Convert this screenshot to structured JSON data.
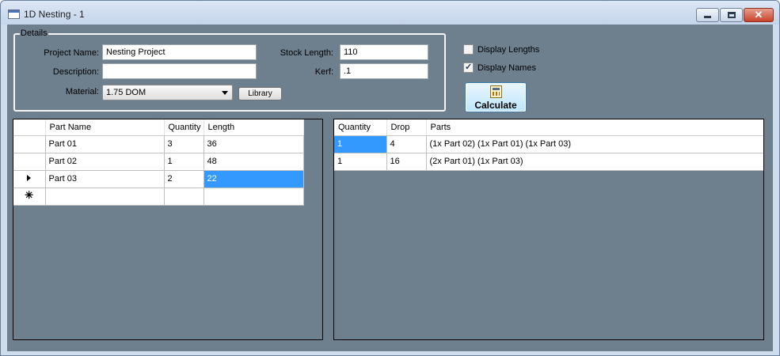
{
  "window": {
    "title": "1D Nesting - 1",
    "close_glyph": "✕"
  },
  "details": {
    "group_label": "Details",
    "project_name_label": "Project Name:",
    "project_name_value": "Nesting Project",
    "description_label": "Description:",
    "description_value": "",
    "material_label": "Material:",
    "material_value": "1.75 DOM",
    "library_button": "Library",
    "stock_length_label": "Stock Length:",
    "stock_length_value": "110",
    "kerf_label": "Kerf:",
    "kerf_value": ".1"
  },
  "options": {
    "display_lengths_label": "Display Lengths",
    "display_lengths_checked": false,
    "display_names_label": "Display Names",
    "display_names_checked": true
  },
  "calculate_button": "Calculate",
  "parts_grid": {
    "columns": [
      "Part Name",
      "Quantity",
      "Length"
    ],
    "new_row_marker": "✳",
    "rows": [
      {
        "name": "Part 01",
        "quantity": "3",
        "length": "36"
      },
      {
        "name": "Part 02",
        "quantity": "1",
        "length": "48"
      },
      {
        "name": "Part 03",
        "quantity": "2",
        "length": "22"
      }
    ],
    "current_row": 2
  },
  "results_grid": {
    "columns": [
      "Quantity",
      "Drop",
      "Parts"
    ],
    "rows": [
      {
        "quantity": "1",
        "drop": "4",
        "parts": "(1x Part 02) (1x Part 01) (1x Part 03)"
      },
      {
        "quantity": "1",
        "drop": "16",
        "parts": "(2x Part 01) (1x Part 03)"
      }
    ]
  },
  "colors": {
    "client_background": "#6e7f8d",
    "selection": "#3399ff"
  }
}
